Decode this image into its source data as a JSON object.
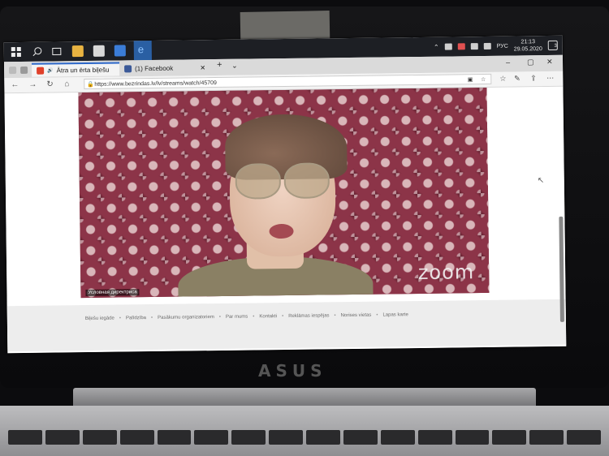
{
  "taskbar": {
    "clock_time": "21:13",
    "clock_date": "29.05.2020",
    "language": "РУС",
    "notification_count": "3"
  },
  "tabs": [
    {
      "title": "Ātra un ērta biļešu",
      "active": true
    },
    {
      "title": "(1) Facebook",
      "active": false
    }
  ],
  "address_bar": {
    "url": "https://www.bezrindas.lv/lv/streams/watch/45709"
  },
  "video": {
    "logo": "zoom",
    "participant_name": "Условная директриса"
  },
  "footer": {
    "links": [
      "Biļešu iegāde",
      "Palīdzība",
      "Pasākumu organizatoriem",
      "Par mums",
      "Kontakti",
      "Reklāmas iespējas",
      "Norises vietas",
      "Lapas karte"
    ]
  },
  "laptop": {
    "brand": "ASUS"
  },
  "colors": {
    "taskbar_bg": "#1d1f24",
    "tab_accent": "#2c67c9",
    "wallpaper": "#7b2a3a"
  }
}
